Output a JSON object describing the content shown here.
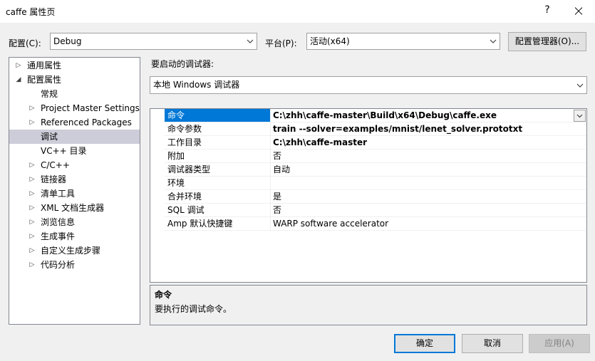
{
  "window": {
    "title": "caffe 属性页",
    "help": "?"
  },
  "config": {
    "label": "配置(C):",
    "value": "Debug"
  },
  "platform": {
    "label": "平台(P):",
    "value": "活动(x64)"
  },
  "config_manager_label": "配置管理器(O)...",
  "tree": [
    {
      "label": "通用属性",
      "expander": "▷",
      "level": 0,
      "selected": false
    },
    {
      "label": "配置属性",
      "expander": "◢",
      "level": 0,
      "selected": false
    },
    {
      "label": "常规",
      "expander": "",
      "level": 1,
      "selected": false
    },
    {
      "label": "Project Master Settings",
      "expander": "▷",
      "level": 1,
      "selected": false
    },
    {
      "label": "Referenced Packages",
      "expander": "▷",
      "level": 1,
      "selected": false
    },
    {
      "label": "调试",
      "expander": "",
      "level": 1,
      "selected": true
    },
    {
      "label": "VC++ 目录",
      "expander": "",
      "level": 1,
      "selected": false
    },
    {
      "label": "C/C++",
      "expander": "▷",
      "level": 1,
      "selected": false
    },
    {
      "label": "链接器",
      "expander": "▷",
      "level": 1,
      "selected": false
    },
    {
      "label": "清单工具",
      "expander": "▷",
      "level": 1,
      "selected": false
    },
    {
      "label": "XML 文档生成器",
      "expander": "▷",
      "level": 1,
      "selected": false
    },
    {
      "label": "浏览信息",
      "expander": "▷",
      "level": 1,
      "selected": false
    },
    {
      "label": "生成事件",
      "expander": "▷",
      "level": 1,
      "selected": false
    },
    {
      "label": "自定义生成步骤",
      "expander": "▷",
      "level": 1,
      "selected": false
    },
    {
      "label": "代码分析",
      "expander": "▷",
      "level": 1,
      "selected": false
    }
  ],
  "debugger": {
    "label": "要启动的调试器:",
    "value": "本地 Windows 调试器"
  },
  "properties": [
    {
      "name": "命令",
      "value": "C:\\zhh\\caffe-master\\Build\\x64\\Debug\\caffe.exe",
      "bold": true,
      "selected": true
    },
    {
      "name": "命令参数",
      "value": "train --solver=examples/mnist/lenet_solver.prototxt",
      "bold": true,
      "selected": false
    },
    {
      "name": "工作目录",
      "value": "C:\\zhh\\caffe-master",
      "bold": true,
      "selected": false
    },
    {
      "name": "附加",
      "value": "否",
      "bold": false,
      "selected": false
    },
    {
      "name": "调试器类型",
      "value": "自动",
      "bold": false,
      "selected": false
    },
    {
      "name": "环境",
      "value": "",
      "bold": false,
      "selected": false
    },
    {
      "name": "合并环境",
      "value": "是",
      "bold": false,
      "selected": false
    },
    {
      "name": "SQL 调试",
      "value": "否",
      "bold": false,
      "selected": false
    },
    {
      "name": "Amp 默认快捷键",
      "value": "WARP software accelerator",
      "bold": false,
      "selected": false
    }
  ],
  "description": {
    "title": "命令",
    "text": "要执行的调试命令。"
  },
  "buttons": {
    "ok": "确定",
    "cancel": "取消",
    "apply": "应用(A)"
  },
  "colors": {
    "selection": "#0078d7",
    "tree_selection": "#cdcdd9"
  }
}
